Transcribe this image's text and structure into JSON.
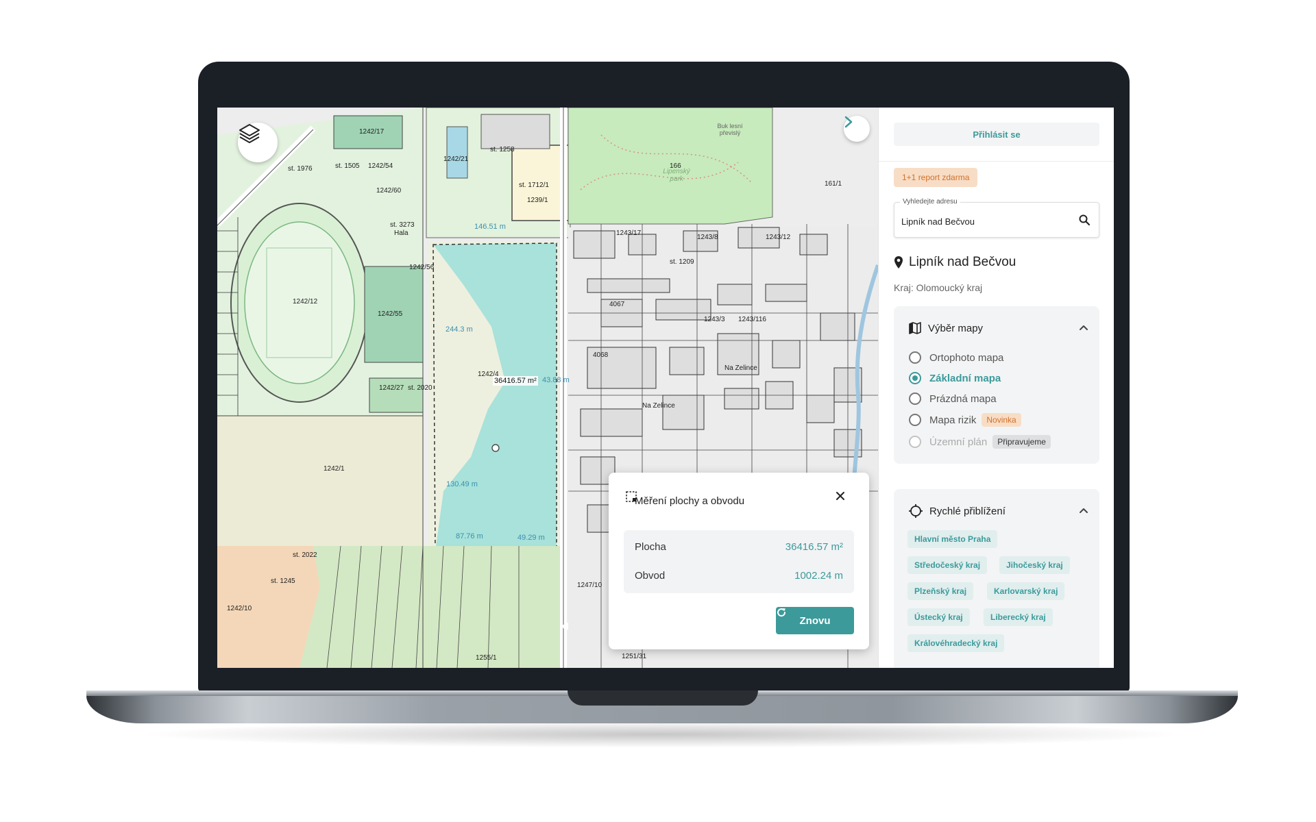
{
  "auth": {
    "login_label": "Přihlásit se"
  },
  "promo": {
    "label": "1+1 report zdarma"
  },
  "search": {
    "label": "Vyhledejte adresu",
    "value": "Lipník nad Bečvou"
  },
  "place": {
    "name": "Lipník nad Bečvou",
    "region": "Kraj: Olomoucký kraj"
  },
  "map_select": {
    "title": "Výběr mapy",
    "options": [
      {
        "label": "Ortophoto mapa",
        "state": "off"
      },
      {
        "label": "Základní mapa",
        "state": "on"
      },
      {
        "label": "Prázdná mapa",
        "state": "off"
      },
      {
        "label": "Mapa rizik",
        "state": "off",
        "badge": "Novinka"
      },
      {
        "label": "Územní plán",
        "state": "disabled",
        "badge": "Připravujeme"
      }
    ]
  },
  "quick_zoom": {
    "title": "Rychlé přiblížení",
    "regions": [
      "Hlavní město Praha",
      "Středočeský kraj",
      "Jihočeský kraj",
      "Plzeňský kraj",
      "Karlovarský kraj",
      "Ústecký kraj",
      "Liberecký kraj",
      "Královéhradecký kraj"
    ]
  },
  "measure": {
    "title": "Měření plochy a obvodu",
    "area_label": "Plocha",
    "area_value": "36416.57 m²",
    "perimeter_label": "Obvod",
    "perimeter_value": "1002.24 m",
    "again_label": "Znovu"
  },
  "map_overlay": {
    "area_label": "36416.57 m²",
    "segments": [
      "146.51 m",
      "244.3 m",
      "43.88 m",
      "130.49 m",
      "87.76 m",
      "49.29 m"
    ]
  },
  "map_labels": [
    "1242/17",
    "st. 1976",
    "st. 1505",
    "1242/54",
    "1242/60",
    "1242/21",
    "st. 1258",
    "1239/1",
    "st. 1712/1",
    "1242/12",
    "1242/55",
    "st. 3273",
    "Hala",
    "1242/56",
    "1242/4",
    "1242/27",
    "st. 2020",
    "1242/1",
    "1242/10",
    "st. 2022",
    "st. 1245",
    "166",
    "Lipenský park",
    "Buk lesní převislý",
    "161/1",
    "1243/17",
    "1243/8",
    "1243/12",
    "st. 1209",
    "4067",
    "4068",
    "Na Zelince",
    "Na Zelince",
    "1243/3",
    "1243/116",
    "1255/1",
    "1251/31",
    "1247/10"
  ],
  "colors": {
    "accent": "#3c9a9a",
    "measure_fill": "#a8e2da",
    "promo_bg": "#f8ddc6"
  }
}
